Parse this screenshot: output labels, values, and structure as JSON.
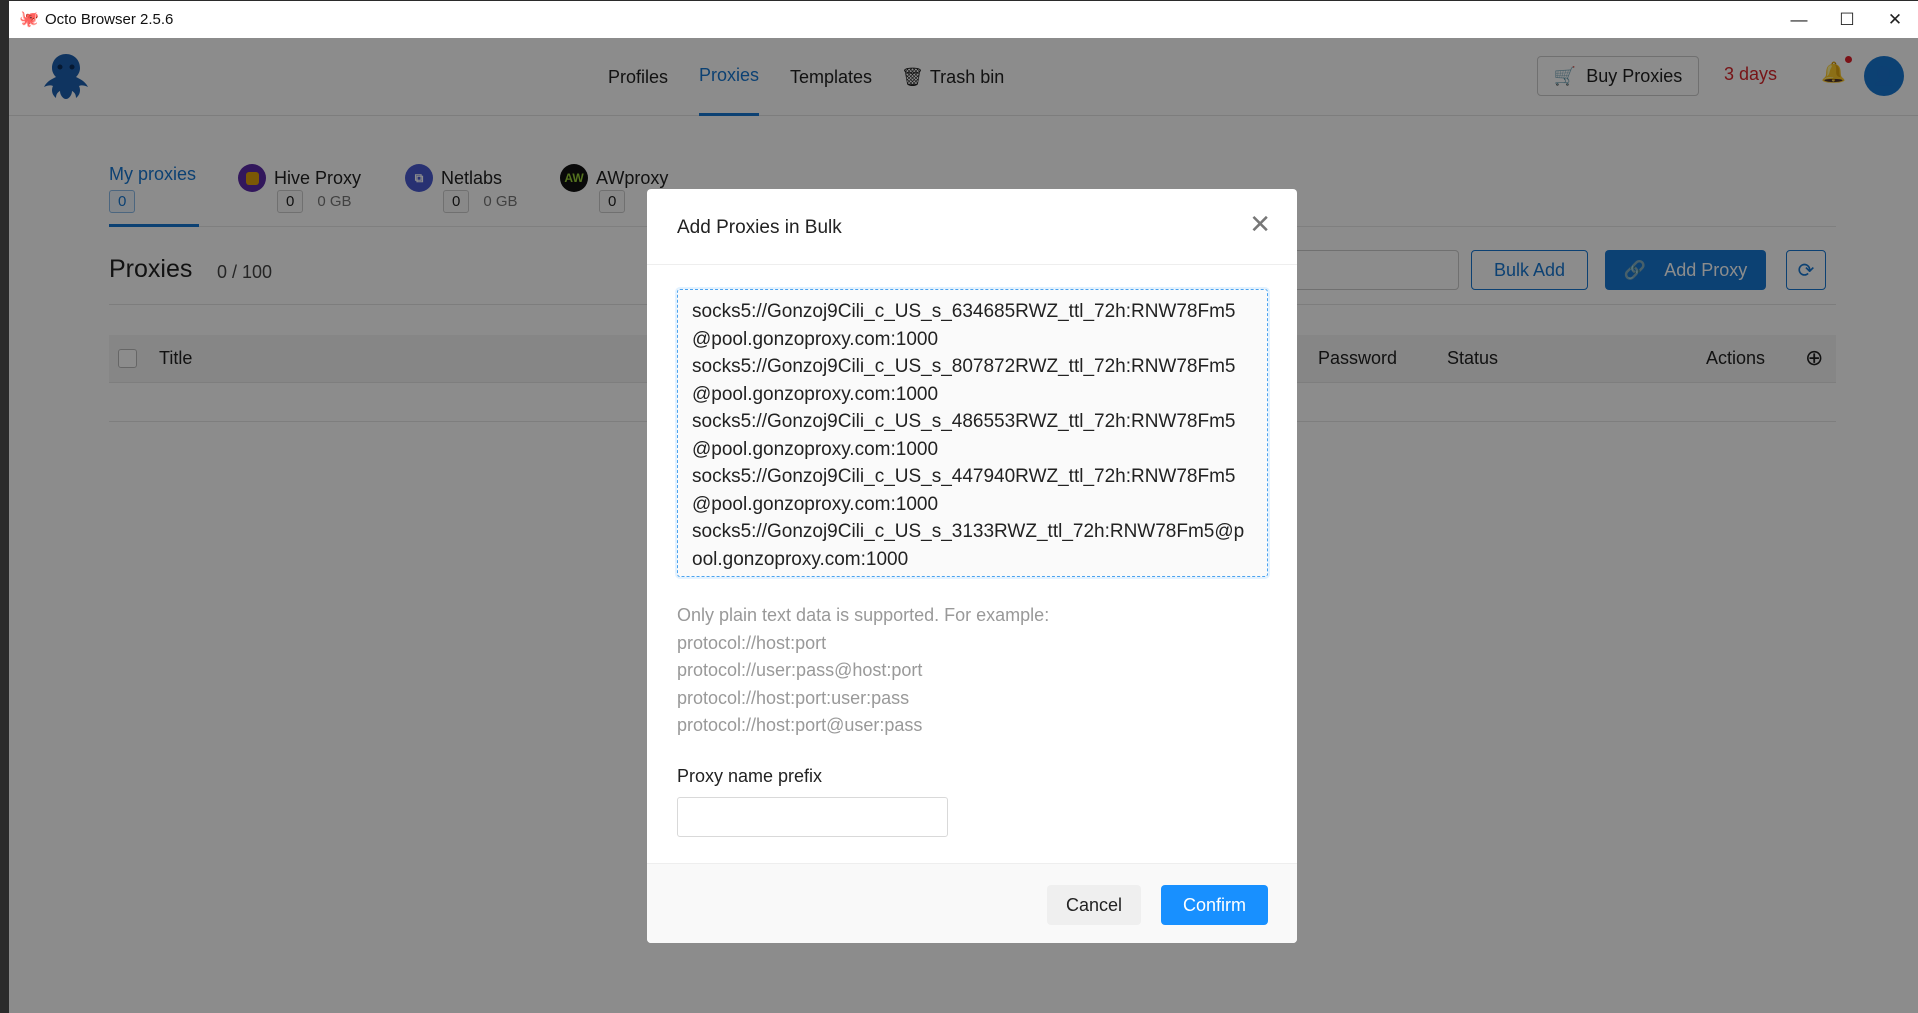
{
  "window": {
    "title": "Octo Browser 2.5.6"
  },
  "nav": {
    "profiles": "Profiles",
    "proxies": "Proxies",
    "templates": "Templates",
    "trash": "Trash bin"
  },
  "header": {
    "buy_proxies": "Buy Proxies",
    "subscription": "3 days"
  },
  "provider_tabs": [
    {
      "label": "My proxies",
      "count": "0"
    },
    {
      "label": "Hive Proxy",
      "count": "0",
      "traffic": "0 GB"
    },
    {
      "label": "Netlabs",
      "count": "0",
      "traffic": "0 GB"
    },
    {
      "label": "AWproxy",
      "count": "0"
    }
  ],
  "proxies": {
    "title": "Proxies",
    "count": "0 / 100",
    "bulk_add": "Bulk Add",
    "add_proxy": "Add Proxy",
    "columns": {
      "title": "Title",
      "password": "Password",
      "status": "Status",
      "actions": "Actions"
    }
  },
  "modal": {
    "title": "Add Proxies in Bulk",
    "textarea_value": "socks5://Gonzoj9Cili_c_US_s_634685RWZ_ttl_72h:RNW78Fm5@pool.gonzoproxy.com:1000\nsocks5://Gonzoj9Cili_c_US_s_807872RWZ_ttl_72h:RNW78Fm5@pool.gonzoproxy.com:1000\nsocks5://Gonzoj9Cili_c_US_s_486553RWZ_ttl_72h:RNW78Fm5@pool.gonzoproxy.com:1000\nsocks5://Gonzoj9Cili_c_US_s_447940RWZ_ttl_72h:RNW78Fm5@pool.gonzoproxy.com:1000\nsocks5://Gonzoj9Cili_c_US_s_3133RWZ_ttl_72h:RNW78Fm5@pool.gonzoproxy.com:1000",
    "help": [
      "Only plain text data is supported. For example:",
      "protocol://host:port",
      "protocol://user:pass@host:port",
      "protocol://host:port:user:pass",
      "protocol://host:port@user:pass"
    ],
    "prefix_label": "Proxy name prefix",
    "prefix_value": "",
    "cancel": "Cancel",
    "confirm": "Confirm"
  }
}
